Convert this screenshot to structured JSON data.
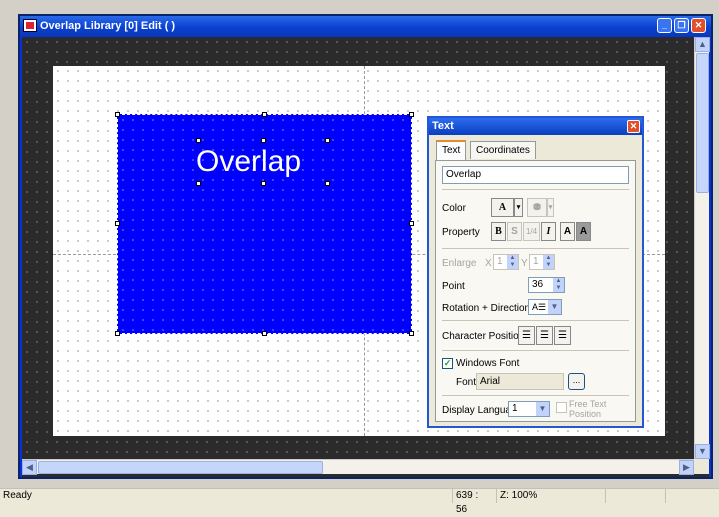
{
  "window": {
    "title": "Overlap Library [0] Edit (          )",
    "buttons": {
      "minimize": "_",
      "restore": "❐",
      "close": "✕"
    }
  },
  "canvas": {
    "overlay_text": "Overlap",
    "overlay_color": "#0000ff"
  },
  "text_panel": {
    "title": "Text",
    "tabs": [
      {
        "label": "Text"
      },
      {
        "label": "Coordinates"
      }
    ],
    "text_value": "Overlap",
    "color_label": "Color",
    "property_label": "Property",
    "property_buttons": [
      "B",
      "S",
      "1/4",
      "I",
      "A",
      "A"
    ],
    "enlarge_label": "Enlarge",
    "enlarge_x_label": "X",
    "enlarge_x_value": "1",
    "enlarge_y_label": "Y",
    "enlarge_y_value": "1",
    "point_label": "Point",
    "point_value": "36",
    "rotation_label": "Rotation + Direction",
    "char_position_label": "Character Position",
    "windows_font_label": "Windows Font",
    "windows_font_checked": true,
    "font_label": "Font",
    "font_value": "Arial",
    "browse_label": "...",
    "display_language_label": "Display Language",
    "display_language_value": "1",
    "free_text_position_label": "Free Text Position"
  },
  "statusbar": {
    "status": "Ready",
    "coords": "639 : 56",
    "zoom": "Z: 100%"
  }
}
